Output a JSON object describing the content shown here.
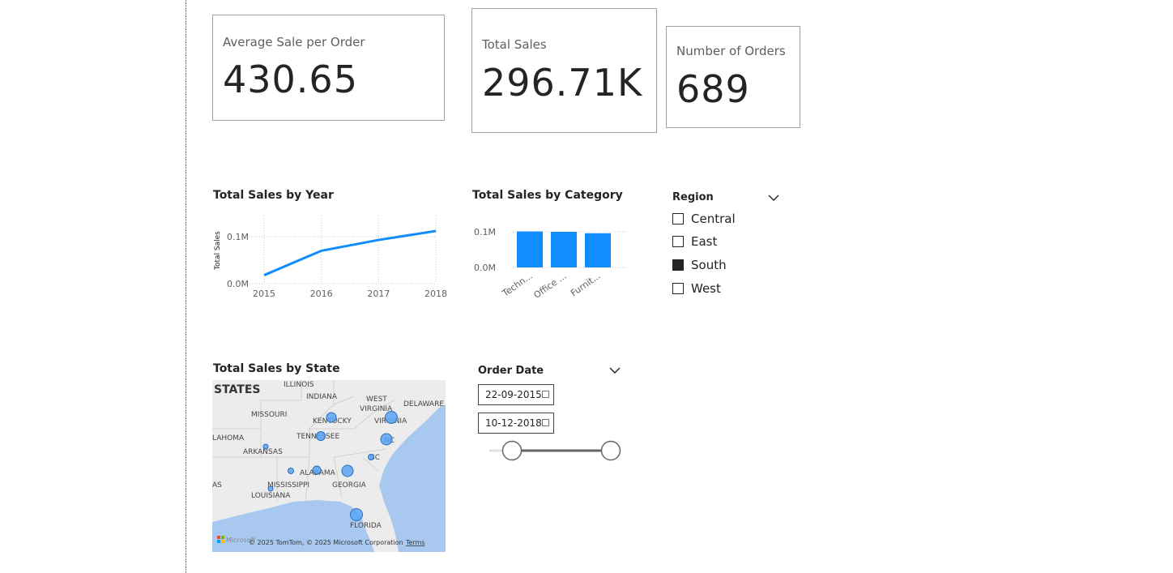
{
  "cards": {
    "avg_sale": {
      "label": "Average Sale per Order",
      "value": "430.65"
    },
    "total_sales": {
      "label": "Total Sales",
      "value": "296.71K"
    },
    "num_orders": {
      "label": "Number of Orders",
      "value": "689"
    }
  },
  "year_chart": {
    "title": "Total Sales by Year",
    "ylabel": "Total Sales",
    "yticks": [
      "0.1M",
      "0.0M"
    ],
    "xticks": [
      "2015",
      "2016",
      "2017",
      "2018"
    ]
  },
  "category_chart": {
    "title": "Total Sales by Category",
    "yticks": [
      "0.1M",
      "0.0M"
    ],
    "xticks": [
      "Techn...",
      "Office ...",
      "Furnit..."
    ]
  },
  "chart_data": [
    {
      "type": "line",
      "title": "Total Sales by Year",
      "xlabel": "",
      "ylabel": "Total Sales",
      "x": [
        "2015",
        "2016",
        "2017",
        "2018"
      ],
      "series": [
        {
          "values": [
            18000,
            70000,
            93000,
            112000
          ]
        }
      ],
      "ylim": [
        0,
        120000
      ],
      "color": "#118dff",
      "grid": true
    },
    {
      "type": "bar",
      "title": "Total Sales by Category",
      "xlabel": "",
      "ylabel": "",
      "categories": [
        "Techn...",
        "Office ...",
        "Furnit..."
      ],
      "values": [
        101000,
        100000,
        96000
      ],
      "ylim": [
        0,
        120000
      ],
      "color": "#118dff",
      "grid": true
    }
  ],
  "region_slicer": {
    "title": "Region",
    "items": [
      {
        "label": "Central",
        "checked": false
      },
      {
        "label": "East",
        "checked": false
      },
      {
        "label": "South",
        "checked": true
      },
      {
        "label": "West",
        "checked": false
      }
    ]
  },
  "map": {
    "title": "Total Sales by State",
    "attribution": "© 2025 TomTom, © 2025 Microsoft Corporation",
    "terms": "Terms",
    "brand": "Microsoft",
    "labels": [
      "STATES",
      "ILLINOIS",
      "INDIANA",
      "WEST",
      "VIRGINIA",
      "DELAWARE",
      "MISSOURI",
      "KENTUCKY",
      "VIRGINIA",
      "LAHOMA",
      "TENNESSEE",
      "NC",
      "ARKANSAS",
      "SC",
      "ALABAMA",
      "MISSISSIPPI",
      "GEORGIA",
      "AS",
      "LOUISIANA",
      "FLORIDA"
    ]
  },
  "date_slicer": {
    "title": "Order Date",
    "start": "22-09-2015",
    "end": "10-12-2018"
  },
  "colors": {
    "accent": "#118dff",
    "map_water": "#a9c8f0",
    "map_land": "#ececec"
  }
}
